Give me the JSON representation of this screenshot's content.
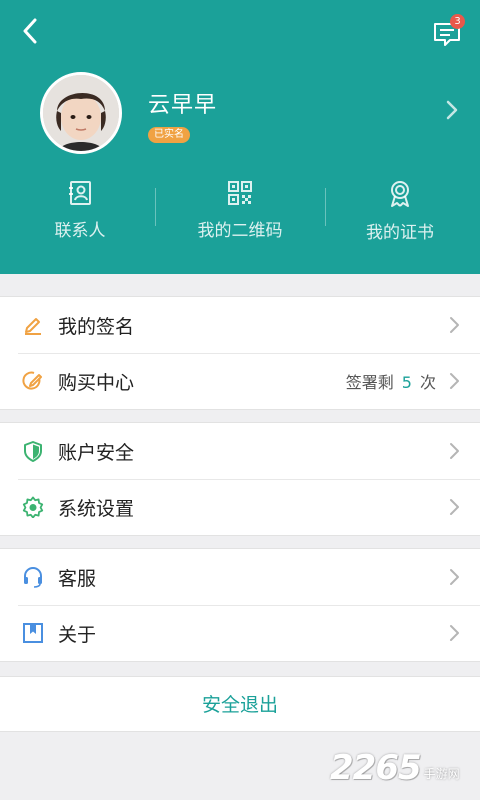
{
  "colors": {
    "primary": "#1ba199",
    "badge": "#e9584b",
    "verified": "#f0a243",
    "background": "#efeff1"
  },
  "header": {
    "back_icon": "chevron-left-icon",
    "message_icon": "message-icon",
    "message_count": "3"
  },
  "profile": {
    "name": "云早早",
    "verified_label": "已实名"
  },
  "quick_actions": [
    {
      "label": "联系人",
      "icon": "contact-card-icon"
    },
    {
      "label": "我的二维码",
      "icon": "qr-code-icon"
    },
    {
      "label": "我的证书",
      "icon": "certificate-icon"
    }
  ],
  "menu": {
    "group1": [
      {
        "label": "我的签名",
        "icon": "pen-icon",
        "icon_color": "#f0a243"
      },
      {
        "label": "购买中心",
        "icon": "edit-circle-icon",
        "icon_color": "#f0a243",
        "extra_prefix": "签署剩",
        "extra_count": "5",
        "extra_suffix": "次"
      }
    ],
    "group2": [
      {
        "label": "账户安全",
        "icon": "shield-icon",
        "icon_color": "#3cb371"
      },
      {
        "label": "系统设置",
        "icon": "gear-icon",
        "icon_color": "#3cb371"
      }
    ],
    "group3": [
      {
        "label": "客服",
        "icon": "headset-icon",
        "icon_color": "#4a8fe0"
      },
      {
        "label": "关于",
        "icon": "bookmark-icon",
        "icon_color": "#4a8fe0"
      }
    ]
  },
  "logout_label": "安全退出",
  "watermark": {
    "number": "2265",
    "text": "手游网"
  }
}
